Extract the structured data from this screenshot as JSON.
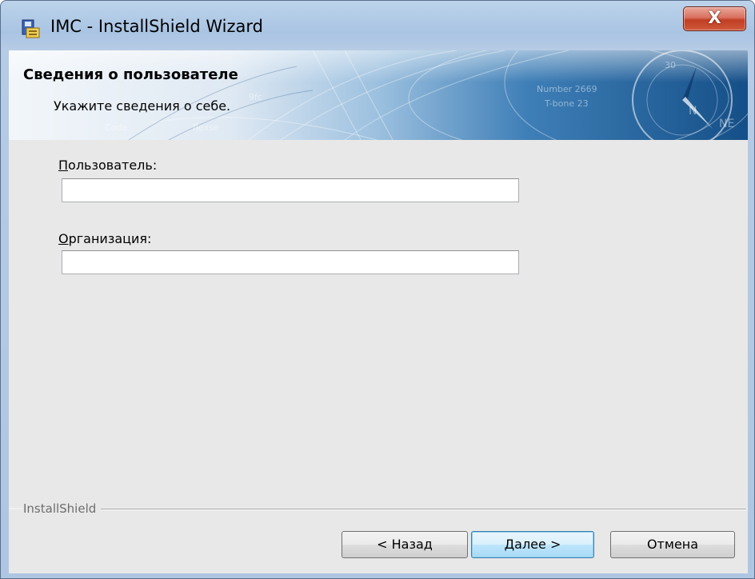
{
  "window": {
    "title": "IMC - InstallShield Wizard",
    "close_symbol": "X",
    "app_icon": "installer-icon"
  },
  "banner": {
    "title": "Сведения о пользователе",
    "subtitle": "Укажите сведения о себе."
  },
  "form": {
    "user_label_first": "П",
    "user_label_rest": "ользователь:",
    "user_value": "",
    "org_label_first": "О",
    "org_label_rest": "рганизация:",
    "org_value": ""
  },
  "footer": {
    "brand": "InstallShield",
    "back_label": "< Назад",
    "next_label": "Далее >",
    "cancel_label": "Отмена"
  },
  "colors": {
    "accent": "#3c7fb1",
    "close": "#c13e24",
    "banner": "#2d6ea3"
  }
}
